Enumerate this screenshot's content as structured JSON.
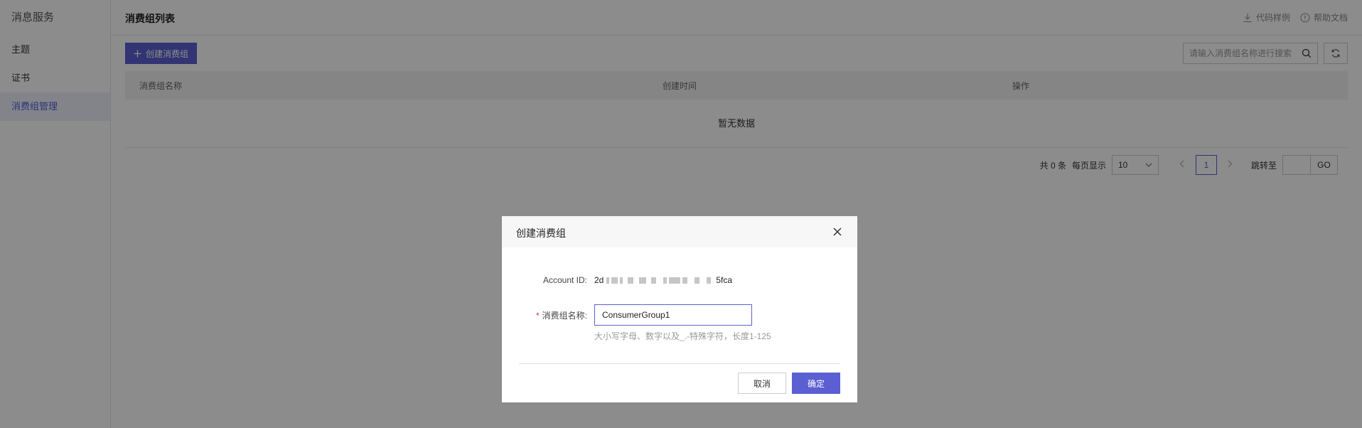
{
  "sidebar": {
    "title": "消息服务",
    "items": [
      {
        "label": "主题"
      },
      {
        "label": "证书"
      },
      {
        "label": "消费组管理"
      }
    ]
  },
  "header": {
    "title": "消费组列表",
    "code_sample": "代码样例",
    "help_doc": "帮助文档"
  },
  "toolbar": {
    "create_label": "创建消费组",
    "search_placeholder": "请输入消费组名称进行搜索"
  },
  "table": {
    "columns": [
      "消费组名称",
      "创建时间",
      "操作"
    ],
    "empty_text": "暂无数据"
  },
  "pagination": {
    "total_text": "共 0 条",
    "per_page_label": "每页显示",
    "per_page_value": "10",
    "current_page": "1",
    "jump_label": "跳转至",
    "go_label": "GO"
  },
  "dialog": {
    "title": "创建消费组",
    "account_label": "Account ID:",
    "account_prefix": "2d",
    "account_suffix": "5fca",
    "name_label": "消费组名称:",
    "name_value": "ConsumerGroup1",
    "hint": "大小写字母、数字以及_.-特殊字符，长度1-125",
    "cancel_label": "取消",
    "ok_label": "确定"
  },
  "colors": {
    "accent": "#5b5fd1",
    "required": "#e02f2f"
  }
}
